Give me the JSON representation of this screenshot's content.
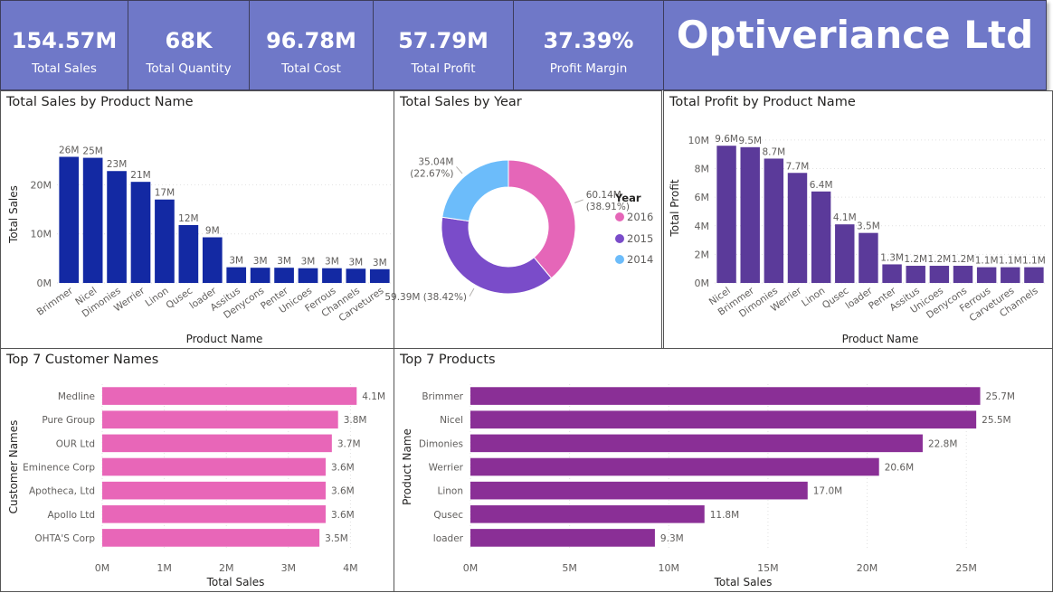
{
  "kpis": [
    {
      "value": "154.57M",
      "label": "Total Sales"
    },
    {
      "value": "68K",
      "label": "Total Quantity"
    },
    {
      "value": "96.78M",
      "label": "Total Cost"
    },
    {
      "value": "57.79M",
      "label": "Total Profit"
    },
    {
      "value": "37.39%",
      "label": "Profit Margin"
    }
  ],
  "brand": {
    "title": "Optiveriance Ltd"
  },
  "colors": {
    "kpi_bg": "#6f78c8",
    "sales_bar": "#1329a3",
    "profit_bar": "#5b3a9a",
    "customer_bar": "#e866b8",
    "product_bar": "#8a2f96",
    "y2016": "#e566b8",
    "y2015": "#7a4cc9",
    "y2014": "#6cbcfa"
  },
  "chart_data": [
    {
      "id": "sales_by_product",
      "type": "bar",
      "title": "Total Sales by Product Name",
      "xlabel": "Product Name",
      "ylabel": "Total Sales",
      "categories": [
        "Brimmer",
        "Nicel",
        "Dimonies",
        "Werrier",
        "Linon",
        "Qusec",
        "loader",
        "Assitus",
        "Denycons",
        "Penter",
        "Unicoes",
        "Ferrous",
        "Channels",
        "Carvetures"
      ],
      "values": [
        25.7,
        25.5,
        22.8,
        20.6,
        17.0,
        11.8,
        9.3,
        3.2,
        3.1,
        3.1,
        3.0,
        3.0,
        2.9,
        2.8
      ],
      "data_labels": [
        "26M",
        "25M",
        "23M",
        "21M",
        "17M",
        "12M",
        "9M",
        "3M",
        "3M",
        "3M",
        "3M",
        "3M",
        "3M",
        "3M"
      ],
      "unit": "M",
      "yticks": [
        0,
        10,
        20
      ],
      "ytick_labels": [
        "0M",
        "10M",
        "20M"
      ],
      "ylim": [
        0,
        28
      ],
      "grid": true
    },
    {
      "id": "sales_by_year",
      "type": "pie",
      "donut": true,
      "title": "Total Sales by Year",
      "legend_title": "Year",
      "legend_position": "right",
      "slices": [
        {
          "name": "2016",
          "value": 60.14,
          "label": "60.14M",
          "pct": "(38.91%)"
        },
        {
          "name": "2015",
          "value": 59.39,
          "label": "59.39M (38.42%)",
          "pct": ""
        },
        {
          "name": "2014",
          "value": 35.04,
          "label": "35.04M",
          "pct": "(22.67%)"
        }
      ],
      "unit": "M"
    },
    {
      "id": "profit_by_product",
      "type": "bar",
      "title": "Total Profit by Product Name",
      "xlabel": "Product Name",
      "ylabel": "Total Profit",
      "categories": [
        "Nicel",
        "Brimmer",
        "Dimonies",
        "Werrier",
        "Linon",
        "Qusec",
        "loader",
        "Penter",
        "Assitus",
        "Unicoes",
        "Denycons",
        "Ferrous",
        "Carvetures",
        "Channels"
      ],
      "values": [
        9.6,
        9.5,
        8.7,
        7.7,
        6.4,
        4.1,
        3.5,
        1.3,
        1.2,
        1.2,
        1.2,
        1.1,
        1.1,
        1.1
      ],
      "data_labels": [
        "9.6M",
        "9.5M",
        "8.7M",
        "7.7M",
        "6.4M",
        "4.1M",
        "3.5M",
        "1.3M",
        "1.2M",
        "1.2M",
        "1.2M",
        "1.1M",
        "1.1M",
        "1.1M"
      ],
      "unit": "M",
      "yticks": [
        0,
        2,
        4,
        6,
        8,
        10
      ],
      "ytick_labels": [
        "0M",
        "2M",
        "4M",
        "6M",
        "8M",
        "10M"
      ],
      "ylim": [
        0,
        10.5
      ],
      "grid": true
    },
    {
      "id": "top_customers",
      "type": "bar",
      "orientation": "horizontal",
      "title": "Top 7 Customer Names",
      "xlabel": "Total Sales",
      "ylabel": "Customer Names",
      "categories": [
        "Medline",
        "Pure Group",
        "OUR Ltd",
        "Eminence Corp",
        "Apotheca, Ltd",
        "Apollo Ltd",
        "OHTA'S Corp"
      ],
      "values": [
        4.1,
        3.8,
        3.7,
        3.6,
        3.6,
        3.6,
        3.5
      ],
      "data_labels": [
        "4.1M",
        "3.8M",
        "3.7M",
        "3.6M",
        "3.6M",
        "3.6M",
        "3.5M"
      ],
      "unit": "M",
      "xticks": [
        0,
        1,
        2,
        3,
        4
      ],
      "xtick_labels": [
        "0M",
        "1M",
        "2M",
        "3M",
        "4M"
      ],
      "xlim": [
        0,
        4.3
      ],
      "grid": true
    },
    {
      "id": "top_products",
      "type": "bar",
      "orientation": "horizontal",
      "title": "Top 7 Products",
      "xlabel": "Total Sales",
      "ylabel": "Product Name",
      "categories": [
        "Brimmer",
        "Nicel",
        "Dimonies",
        "Werrier",
        "Linon",
        "Qusec",
        "loader"
      ],
      "values": [
        25.7,
        25.5,
        22.8,
        20.6,
        17.0,
        11.8,
        9.3
      ],
      "data_labels": [
        "25.7M",
        "25.5M",
        "22.8M",
        "20.6M",
        "17.0M",
        "11.8M",
        "9.3M"
      ],
      "unit": "M",
      "xticks": [
        0,
        5,
        10,
        15,
        20,
        25
      ],
      "xtick_labels": [
        "0M",
        "5M",
        "10M",
        "15M",
        "20M",
        "25M"
      ],
      "xlim": [
        0,
        27.5
      ],
      "grid": true
    }
  ]
}
